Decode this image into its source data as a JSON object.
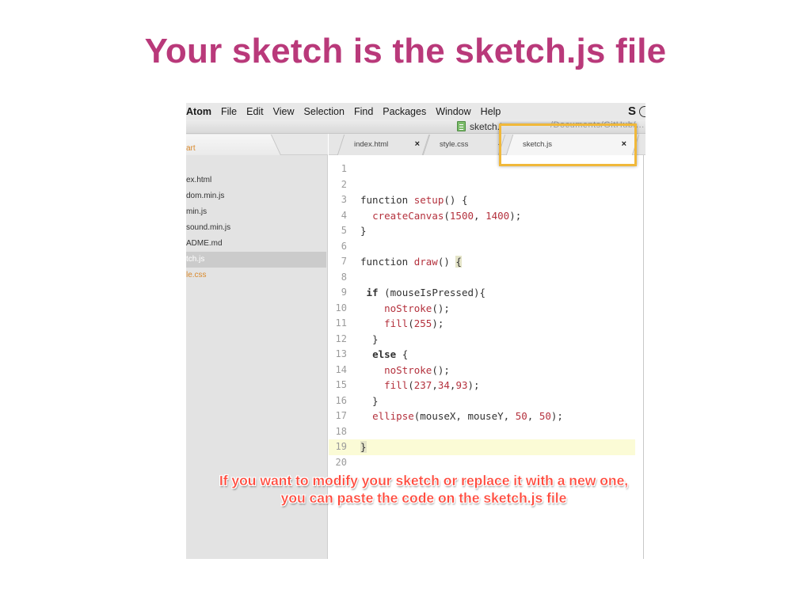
{
  "slide": {
    "title": "Your sketch is the sketch.js file",
    "caption": "If you want to modify your sketch or replace it with a new one, you can paste the code on the sketch.js file"
  },
  "colors": {
    "title": "#b9397a",
    "caption": "#ff4a3d",
    "highlight_box": "#f0b83a",
    "tree_orange": "#d9892b",
    "code_red": "#b4313d"
  },
  "menubar": {
    "app": "Atom",
    "items": [
      "File",
      "Edit",
      "View",
      "Selection",
      "Find",
      "Packages",
      "Window",
      "Help"
    ],
    "tray_icon": "S"
  },
  "window": {
    "title": "sketch.j",
    "path": "/Documents/GitHub/..."
  },
  "sidebar": {
    "items": [
      {
        "label": "art",
        "style": "orange"
      },
      {
        "label": "",
        "style": ""
      },
      {
        "label": "ex.html",
        "style": ""
      },
      {
        "label": "dom.min.js",
        "style": ""
      },
      {
        "label": "min.js",
        "style": ""
      },
      {
        "label": "sound.min.js",
        "style": ""
      },
      {
        "label": "ADME.md",
        "style": ""
      },
      {
        "label": "tch.js",
        "style": "selected"
      },
      {
        "label": "le.css",
        "style": "orange"
      }
    ]
  },
  "tabs": [
    {
      "label": "index.html",
      "close": "×"
    },
    {
      "label": "style.css",
      "close": ""
    },
    {
      "label": "sketch.js",
      "close": "×"
    }
  ],
  "tab_chevron": "‹",
  "code": {
    "lines": [
      "",
      "",
      "function setup() {",
      "  createCanvas(1500, 1400);",
      "}",
      "",
      "function draw() {",
      "",
      " if (mouseIsPressed){",
      "    noStroke();",
      "    fill(255);",
      "  }",
      "  else {",
      "    noStroke();",
      "    fill(237,34,93);",
      "  }",
      "  ellipse(mouseX, mouseY, 50, 50);",
      "",
      "}",
      ""
    ],
    "cursor_line": 19
  }
}
